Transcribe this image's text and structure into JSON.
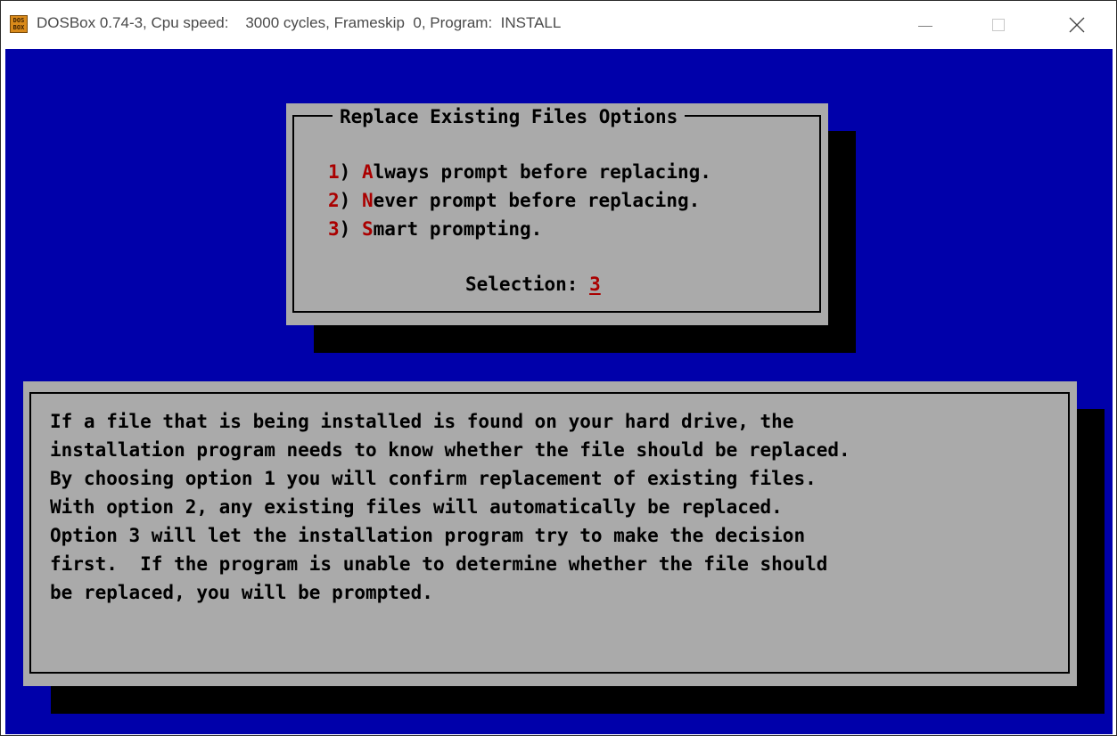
{
  "window": {
    "title": "DOSBox 0.74-3, Cpu speed:    3000 cycles, Frameskip  0, Program:  INSTALL",
    "icon_text_top": "DOS",
    "icon_text_bottom": "BOX",
    "icon_name": "dosbox-app-icon",
    "controls": {
      "minimize": "minimize-icon",
      "maximize": "maximize-icon",
      "close": "close-icon"
    }
  },
  "colors": {
    "background": "#0000aa",
    "dialog": "#aaaaaa",
    "highlight": "#aa0000",
    "shadow": "#000000"
  },
  "dialog": {
    "title": "Replace Existing Files Options",
    "options": [
      {
        "num": "1",
        "key": "A",
        "rest": "lways prompt before replacing."
      },
      {
        "num": "2",
        "key": "N",
        "rest": "ever prompt before replacing."
      },
      {
        "num": "3",
        "key": "S",
        "rest": "mart prompting."
      }
    ],
    "selection_label": "Selection: ",
    "selection_value": "3"
  },
  "help": {
    "lines": [
      "If a file that is being installed is found on your hard drive, the",
      "installation program needs to know whether the file should be replaced.",
      "By choosing option 1 you will confirm replacement of existing files.",
      "With option 2, any existing files will automatically be replaced.",
      "Option 3 will let the installation program try to make the decision",
      "first.  If the program is unable to determine whether the file should",
      "be replaced, you will be prompted."
    ]
  }
}
